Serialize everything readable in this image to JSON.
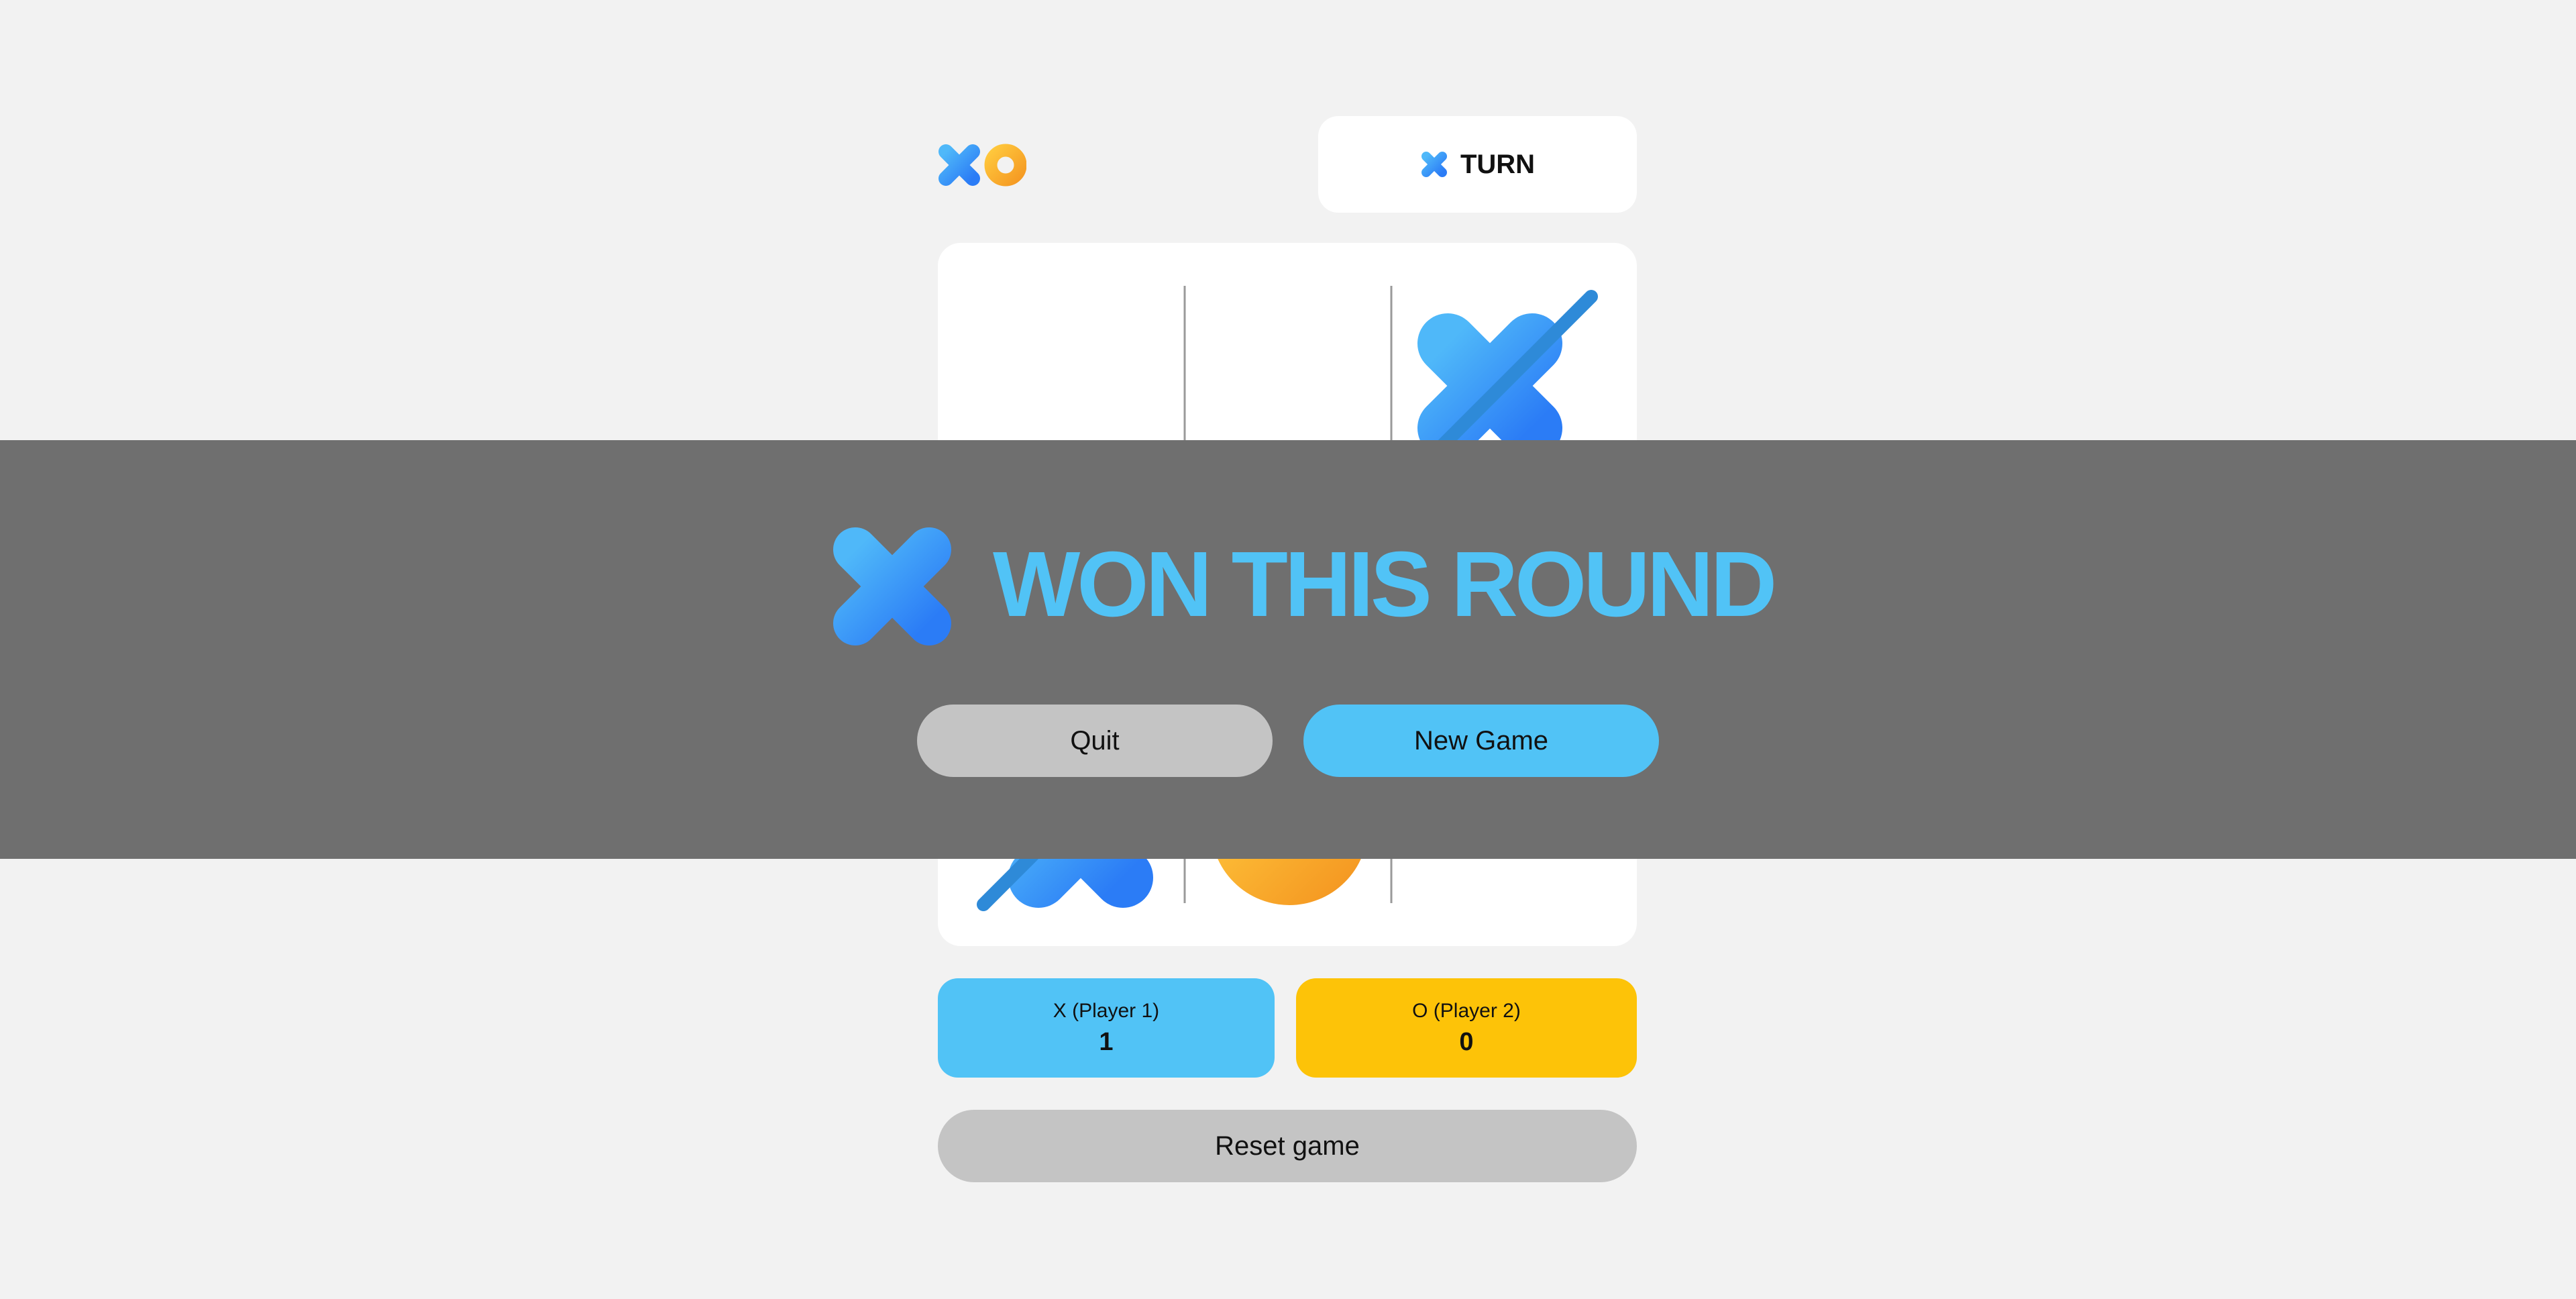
{
  "header": {
    "logo_icons": [
      "x-mark-icon",
      "o-mark-icon"
    ],
    "turn": {
      "player_icon": "x-mark-icon",
      "label": "TURN"
    }
  },
  "board": {
    "cells": [
      "",
      "",
      "X",
      "",
      "",
      "",
      "X",
      "O",
      ""
    ],
    "winning_line": "diagonal from bottom-left to top-right",
    "visible_note": "cells partially hidden behind the result overlay"
  },
  "scores": {
    "x": {
      "label": "X (Player 1)",
      "value": "1"
    },
    "o": {
      "label": "O (Player 2)",
      "value": "0"
    }
  },
  "reset_label": "Reset game",
  "result": {
    "winner_icon": "x-mark-icon",
    "message": "WON THIS ROUND",
    "quit_label": "Quit",
    "new_game_label": "New Game"
  },
  "colors": {
    "background": "#f2f2f2",
    "x_blue_light": "#4fb8f9",
    "x_blue_dark": "#2b7cf6",
    "o_orange": "#f5a623",
    "score_x": "#51c3f6",
    "score_o": "#fdc308",
    "overlay": "#6f6f6f",
    "button_gray": "#c4c4c4",
    "win_line": "#2e8ad8"
  }
}
